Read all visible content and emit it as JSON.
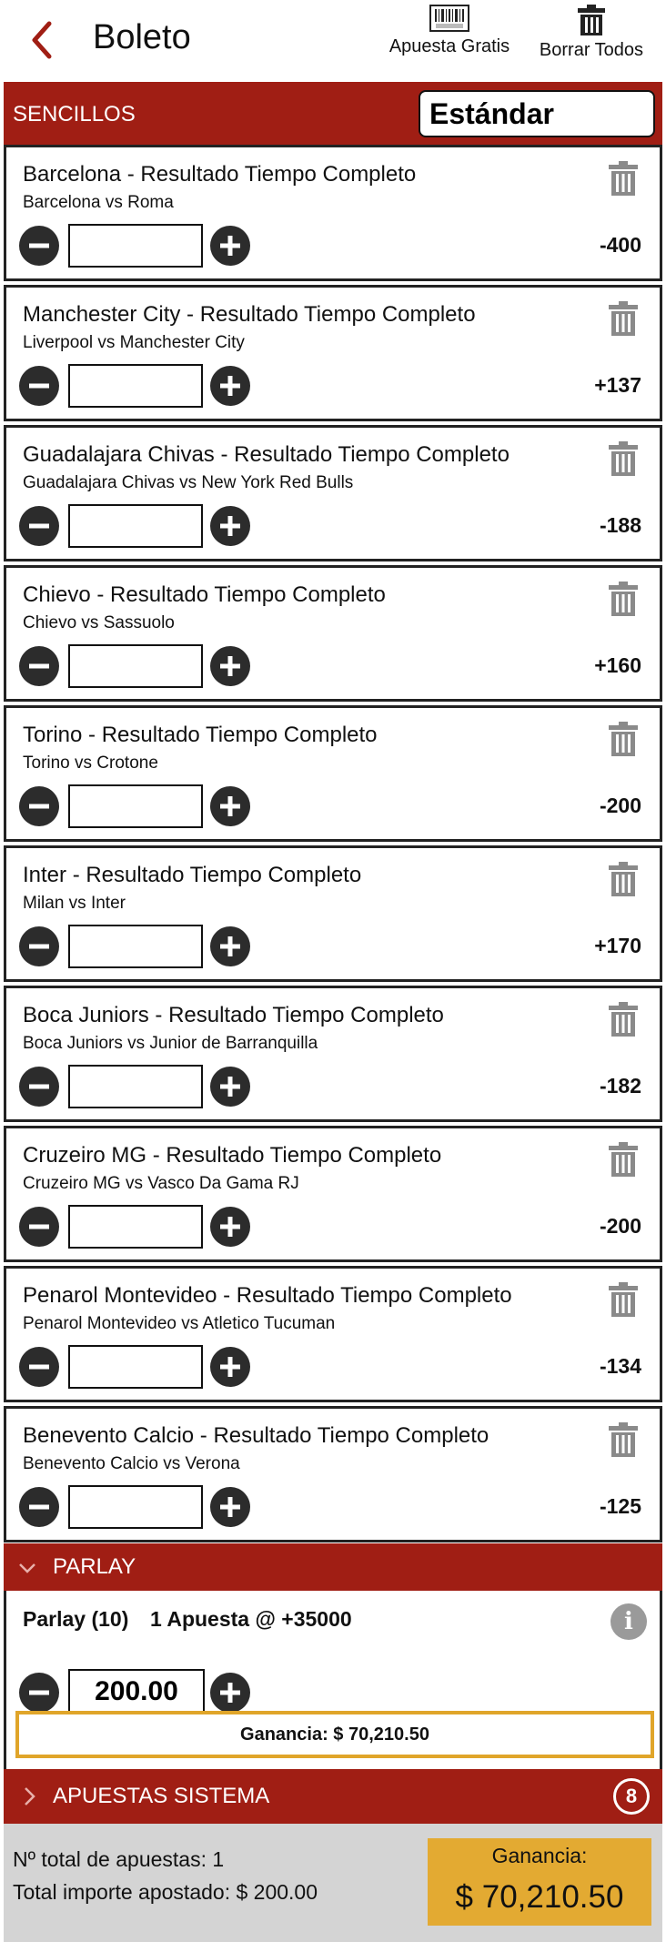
{
  "header": {
    "title": "Boleto",
    "free_bet_label": "Apuesta Gratis",
    "clear_all_label": "Borrar Todos"
  },
  "sencillos": {
    "title": "SENCILLOS",
    "mode_value": "Estándar"
  },
  "bets": [
    {
      "title": "Barcelona - Resultado Tiempo Completo",
      "match": "Barcelona vs Roma",
      "odds": "-400",
      "stake": ""
    },
    {
      "title": "Manchester City - Resultado Tiempo Completo",
      "match": "Liverpool vs Manchester City",
      "odds": "+137",
      "stake": ""
    },
    {
      "title": "Guadalajara Chivas - Resultado Tiempo Completo",
      "match": "Guadalajara Chivas vs New York Red Bulls",
      "odds": "-188",
      "stake": ""
    },
    {
      "title": "Chievo - Resultado Tiempo Completo",
      "match": "Chievo vs Sassuolo",
      "odds": "+160",
      "stake": ""
    },
    {
      "title": "Torino - Resultado Tiempo Completo",
      "match": "Torino vs Crotone",
      "odds": "-200",
      "stake": ""
    },
    {
      "title": "Inter - Resultado Tiempo Completo",
      "match": "Milan vs Inter",
      "odds": "+170",
      "stake": ""
    },
    {
      "title": "Boca Juniors - Resultado Tiempo Completo",
      "match": "Boca Juniors vs Junior de Barranquilla",
      "odds": "-182",
      "stake": ""
    },
    {
      "title": "Cruzeiro MG - Resultado Tiempo Completo",
      "match": "Cruzeiro MG vs Vasco Da Gama RJ",
      "odds": "-200",
      "stake": ""
    },
    {
      "title": "Penarol Montevideo - Resultado Tiempo Completo",
      "match": "Penarol Montevideo vs Atletico Tucuman",
      "odds": "-134",
      "stake": ""
    },
    {
      "title": "Benevento Calcio - Resultado Tiempo Completo",
      "match": "Benevento Calcio vs Verona",
      "odds": "-125",
      "stake": ""
    }
  ],
  "parlay": {
    "section_title": "PARLAY",
    "label": "Parlay (10)",
    "summary": "1 Apuesta @ +35000",
    "stake": "200.00",
    "winnings": "Ganancia: $ 70,210.50"
  },
  "system": {
    "title": "APUESTAS SISTEMA",
    "count": "8"
  },
  "footer": {
    "total_bets": "Nº total de apuestas: 1",
    "total_amount": "Total importe apostado: $ 200.00",
    "win_label": "Ganancia:",
    "win_value": "$ 70,210.50"
  },
  "colors": {
    "accent": "#a01e14",
    "highlight": "#e3aa32",
    "footer_bg": "#d4d4d4"
  }
}
